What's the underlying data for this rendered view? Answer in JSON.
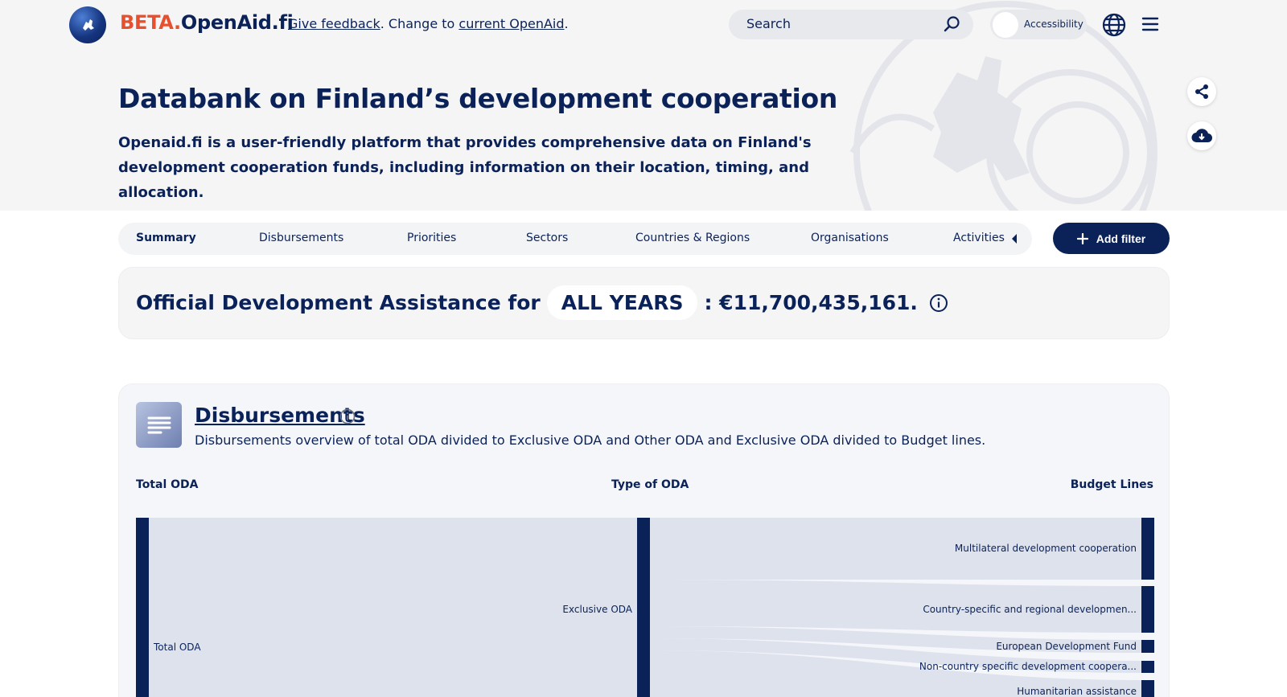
{
  "header": {
    "logo_beta": "BETA.",
    "logo_rest": "OpenAid.fi",
    "feedback_link": "Give feedback",
    "feedback_mid": ". Change to ",
    "current_link": "current OpenAid",
    "feedback_end": ".",
    "search_placeholder": "Search",
    "accessibility_label": "Accessibility"
  },
  "hero": {
    "title": "Databank on Finland’s development cooperation",
    "description": "Openaid.fi is a user-friendly platform that provides comprehensive data on Finland's development cooperation funds, including information on their location, timing, and allocation."
  },
  "tabs": [
    {
      "label": "Summary",
      "active": true
    },
    {
      "label": "Disbursements",
      "active": false
    },
    {
      "label": "Priorities",
      "active": false
    },
    {
      "label": "Sectors",
      "active": false
    },
    {
      "label": "Countries & Regions",
      "active": false
    },
    {
      "label": "Organisations",
      "active": false
    },
    {
      "label": "Activities",
      "active": false
    }
  ],
  "add_filter_label": "Add filter",
  "oda": {
    "prefix": "Official Development Assistance for",
    "period": "ALL YEARS",
    "amount": ": €11,700,435,161."
  },
  "disbursements": {
    "title": "Disbursements",
    "description": "Disbursements overview of total ODA divided to Exclusive ODA and Other ODA and Exclusive ODA divided to Budget lines.",
    "columns": {
      "left": "Total ODA",
      "middle": "Type of ODA",
      "right": "Budget Lines"
    },
    "nodes": {
      "total": "Total ODA",
      "exclusive": "Exclusive ODA",
      "budget_lines": [
        "Multilateral development cooperation",
        "Country-specific and regional developmen...",
        "European Development Fund",
        "Non-country specific development coopera...",
        "Humanitarian assistance"
      ]
    }
  },
  "colors": {
    "navy": "#0b2259",
    "beta_orange": "#e6502f",
    "link_fill": "#dde2ec",
    "hero_bg": "#f5f5f6"
  }
}
